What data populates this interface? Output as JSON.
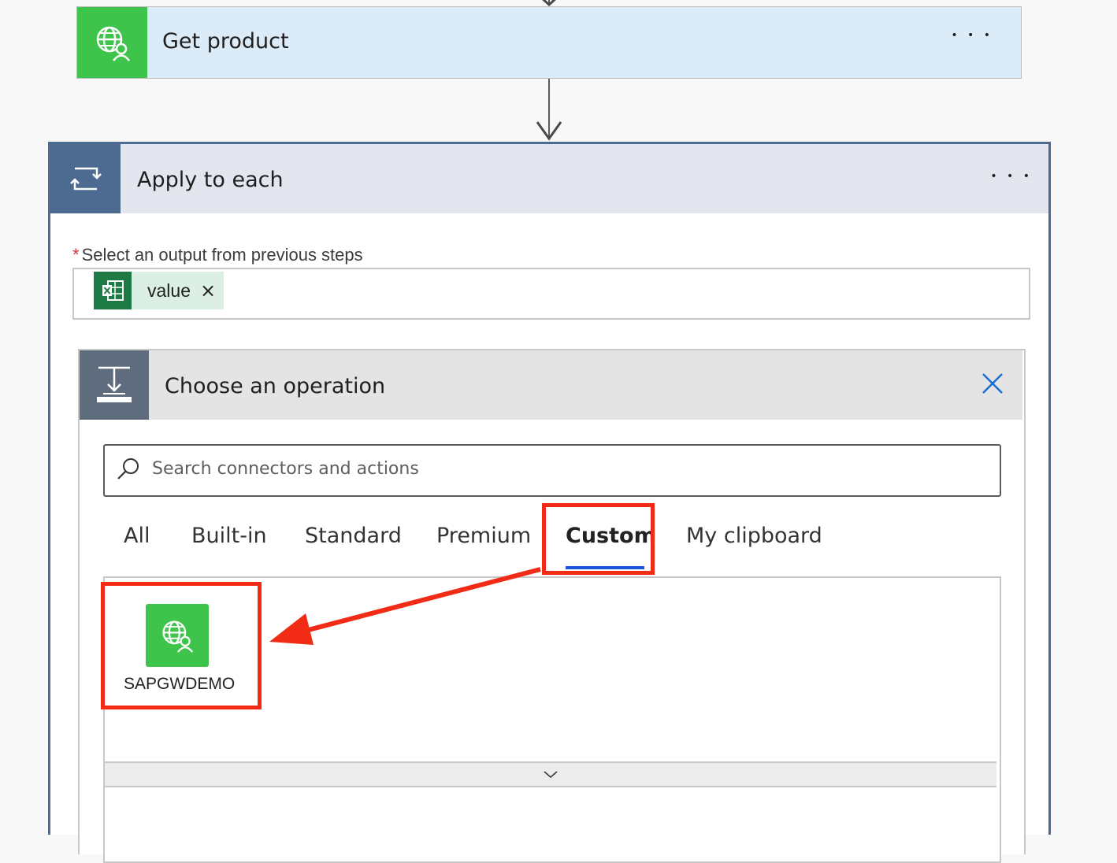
{
  "get_product": {
    "title": "Get product",
    "more": "• • •",
    "icon": "globe-person-icon",
    "color": "#3fc44b"
  },
  "apply_each": {
    "title": "Apply to each",
    "more": "• • •",
    "icon": "loop-icon",
    "color": "#4d6a90"
  },
  "output_field": {
    "required_mark": "*",
    "label": "Select an output from previous steps",
    "token_label": "value",
    "token_icon": "excel-icon",
    "remove_icon": "×"
  },
  "operation": {
    "title": "Choose an operation",
    "search_placeholder": "Search connectors and actions",
    "tabs": [
      "All",
      "Built-in",
      "Standard",
      "Premium",
      "Custom",
      "My clipboard"
    ],
    "active_tab": "Custom",
    "connectors": [
      {
        "label": "SAPGWDEMO",
        "icon": "globe-person-icon"
      }
    ]
  },
  "annotation_color": "#f12b15"
}
